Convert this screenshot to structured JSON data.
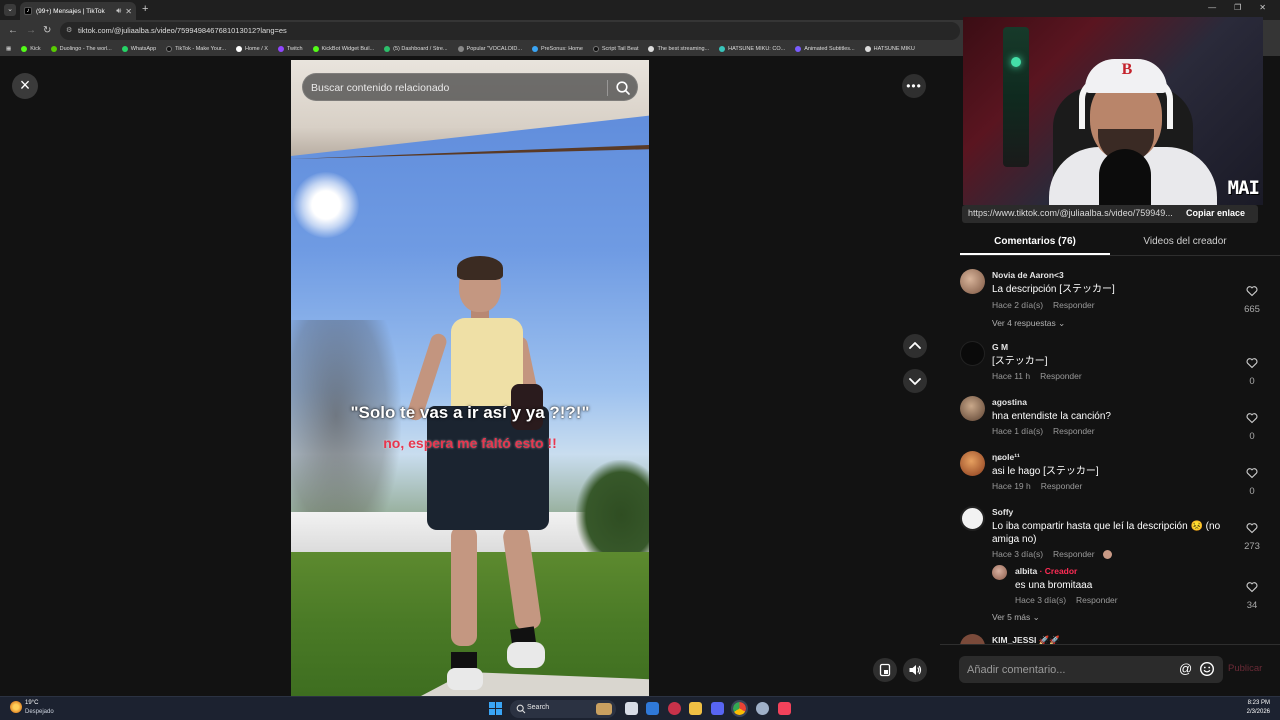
{
  "browser": {
    "tab_title": "(99+) Mensajes | TikTok",
    "url": "tiktok.com/@juliaalba.s/video/7599498467681013012?lang=es",
    "bookmarks": [
      "Kick",
      "Duolingo - The worl...",
      "WhatsApp",
      "TikTok - Make Your...",
      "Home / X",
      "Twitch",
      "KickBot Widget Buil...",
      "(5) Dashboard / Stre...",
      "Popular \"VOCALOID...",
      "PreSonus: Home",
      "Script Tail Beat",
      "The best streaming...",
      "HATSUNE MIKU: CO...",
      "Animated Subtitles...",
      "HATSUNE MIKU"
    ]
  },
  "viewer": {
    "search_placeholder": "Buscar contenido relacionado",
    "caption_main": "\"Solo te vas a ir así y ya ?!?!\"",
    "caption_sub": "no, espera me faltó esto !!"
  },
  "webcam": {
    "tag": "MAI"
  },
  "panel": {
    "link_url": "https://www.tiktok.com/@juliaalba.s/video/759949...",
    "copy_link": "Copiar enlace",
    "tabs": {
      "comments": "Comentarios (76)",
      "creator_videos": "Videos del creador"
    },
    "comments": [
      {
        "user": "Novia de Aaron<3",
        "text": "La descripción [ステッカー]",
        "time": "Hace 2 día(s)",
        "reply": "Responder",
        "likes": "665",
        "more": "Ver 4 respuestas"
      },
      {
        "user": "G M",
        "text": "[ステッカー]",
        "time": "Hace 11 h",
        "reply": "Responder",
        "likes": "0"
      },
      {
        "user": "agostina",
        "text": "hna entendiste la canción?",
        "time": "Hace 1 día(s)",
        "reply": "Responder",
        "likes": "0"
      },
      {
        "user": "ηɕole¹¹",
        "text": "asi le hago [ステッカー]",
        "time": "Hace 19 h",
        "reply": "Responder",
        "likes": "0"
      },
      {
        "user": "Soffy",
        "text": "Lo iba compartir hasta que leí la descripción 😣 (no amiga no)",
        "time": "Hace 3 día(s)",
        "reply": "Responder",
        "likes": "273",
        "more": "Ver 5 más"
      }
    ],
    "reply": {
      "user": "albita",
      "badge": "· Creador",
      "text": "es una bromitaaa",
      "time": "Hace 3 día(s)",
      "reply": "Responder",
      "likes": "34"
    },
    "cut_user": "KIM_JESSI 🚀🚀",
    "comment_placeholder": "Añadir comentario...",
    "publish": "Publicar"
  },
  "taskbar": {
    "temp": "19°C",
    "weather": "Despejado",
    "search": "Search",
    "time": "8:23 PM",
    "date": "2/3/2026"
  }
}
